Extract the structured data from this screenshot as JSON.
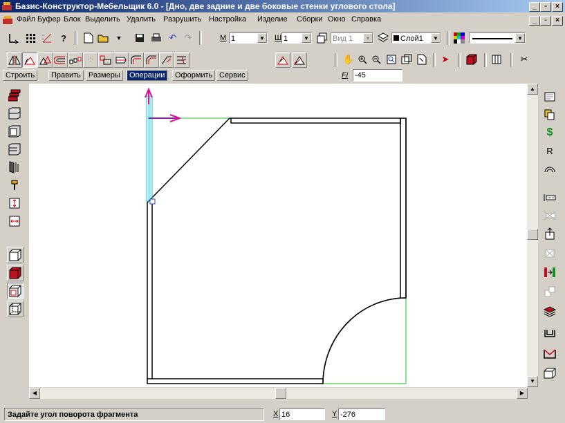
{
  "window": {
    "title": "Базис-Конструктор-Мебельщик 6.0 - [Дно,  две задние и две боковые стенки углового стола]",
    "controls": [
      "_",
      "▫",
      "×"
    ]
  },
  "menu": [
    "Файл",
    "Буфер",
    "Блок",
    "Выделить",
    "Удалить",
    "Разрушить",
    "Настройка",
    "Изделие",
    "Сборки",
    "Окно",
    "Справка"
  ],
  "toolbar": {
    "m_label": "М",
    "m_value": "1",
    "sh_label": "Ш",
    "sh_value": "1",
    "view_value": "Вид 1",
    "layer_value": "Слой1",
    "angle_label": "Fi",
    "angle_value": "-45"
  },
  "tabs": [
    {
      "label": "Строить",
      "active": false
    },
    {
      "label": "Править",
      "active": false
    },
    {
      "label": "Размеры",
      "active": false
    },
    {
      "label": "Операции",
      "active": true
    },
    {
      "label": "Оформить",
      "active": false
    },
    {
      "label": "Сервис",
      "active": false
    }
  ],
  "right_panel": {
    "r_label": "R",
    "dollar_label": "$"
  },
  "status": {
    "prompt": "Задайте угол поворота фрагмента",
    "x_label": "X",
    "x_value": "16",
    "y_label": "Y",
    "y_value": "-276"
  },
  "colors": {
    "title_start": "#0a246a",
    "title_end": "#a6caf0",
    "guide_green": "#1fc01f",
    "selection_cyan": "#00c8e0",
    "axis_magenta": "#e01090",
    "axis_purple": "#7a1fa0"
  }
}
